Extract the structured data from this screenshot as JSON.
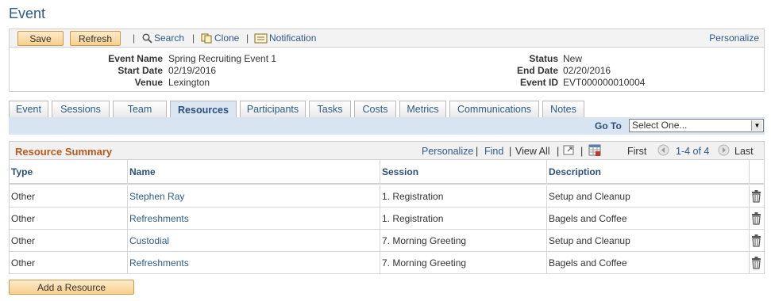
{
  "page": {
    "title": "Event"
  },
  "toolbar": {
    "save": "Save",
    "refresh": "Refresh",
    "search": "Search",
    "clone": "Clone",
    "notification": "Notification",
    "personalize": "Personalize"
  },
  "event": {
    "name_label": "Event Name",
    "name": "Spring Recruiting Event 1",
    "start_label": "Start Date",
    "start": "02/19/2016",
    "venue_label": "Venue",
    "venue": "Lexington",
    "status_label": "Status",
    "status": "New",
    "end_label": "End Date",
    "end": "02/20/2016",
    "id_label": "Event ID",
    "id": "EVT000000010004"
  },
  "tabs": [
    "Event",
    "Sessions",
    "Team",
    "Resources",
    "Participants",
    "Tasks",
    "Costs",
    "Metrics",
    "Communications",
    "Notes"
  ],
  "active_tab": "Resources",
  "goto": {
    "label": "Go To",
    "selected": "Select One..."
  },
  "grid": {
    "title": "Resource Summary",
    "personalize": "Personalize",
    "find": "Find",
    "view_all": "View All",
    "first": "First",
    "range": "1-4 of 4",
    "last": "Last",
    "columns": [
      "Type",
      "Name",
      "Session",
      "Description"
    ],
    "rows": [
      {
        "type": "Other",
        "name": "Stephen Ray",
        "session": "1. Registration",
        "description": "Setup and Cleanup"
      },
      {
        "type": "Other",
        "name": "Refreshments",
        "session": "1. Registration",
        "description": "Bagels and Coffee"
      },
      {
        "type": "Other",
        "name": "Custodial",
        "session": "7. Morning Greeting",
        "description": "Setup and Cleanup"
      },
      {
        "type": "Other",
        "name": "Refreshments",
        "session": "7. Morning Greeting",
        "description": "Bagels and Coffee"
      }
    ]
  },
  "add_resource": "Add a Resource",
  "colors": {
    "link": "#2c5a8a",
    "grid_title": "#b8591e",
    "button": "#f6cf8c",
    "goto_bar": "#d8e4f2"
  }
}
